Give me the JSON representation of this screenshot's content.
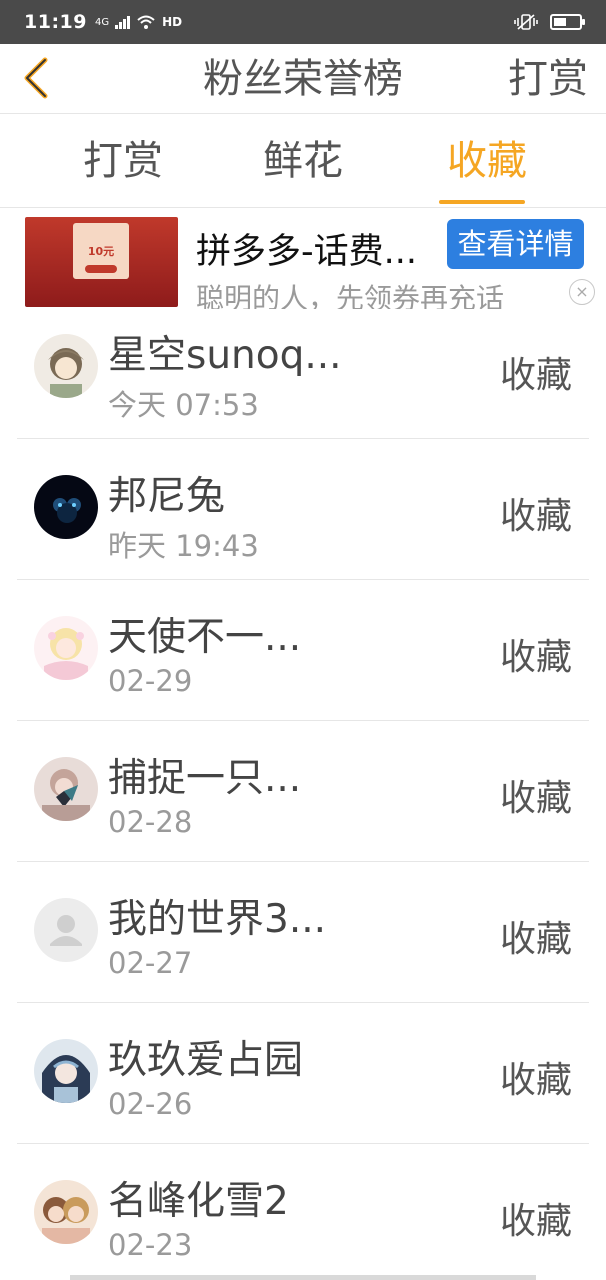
{
  "status_bar": {
    "time": "11:19",
    "network": "4G",
    "hd": "HD",
    "battery_level": 0.48
  },
  "nav": {
    "back_icon": "chevron-left-icon",
    "title": "粉丝荣誉榜",
    "action": "打赏"
  },
  "tabs": [
    {
      "label": "打赏",
      "active": false
    },
    {
      "label": "鲜花",
      "active": false
    },
    {
      "label": "收藏",
      "active": true
    }
  ],
  "ad": {
    "title": "拼多多-话费...",
    "description": "聪明的人，先领券再充话",
    "cta": "查看详情",
    "close": "×",
    "image_amount": "10元"
  },
  "list": [
    {
      "name": "星空sunoq...",
      "time": "今天 07:53",
      "action": "收藏"
    },
    {
      "name": "邦尼兔",
      "time": "昨天 19:43",
      "action": "收藏"
    },
    {
      "name": "天使不一...",
      "time": "02-29",
      "action": "收藏"
    },
    {
      "name": "捕捉一只...",
      "time": "02-28",
      "action": "收藏"
    },
    {
      "name": "我的世界3...",
      "time": "02-27",
      "action": "收藏"
    },
    {
      "name": "玖玖爱占园",
      "time": "02-26",
      "action": "收藏"
    },
    {
      "name": "名峰化雪2",
      "time": "02-23",
      "action": "收藏"
    }
  ],
  "colors": {
    "accent": "#f5a623",
    "cta": "#2d7fe0",
    "status_bar": "#4a4a4a"
  }
}
